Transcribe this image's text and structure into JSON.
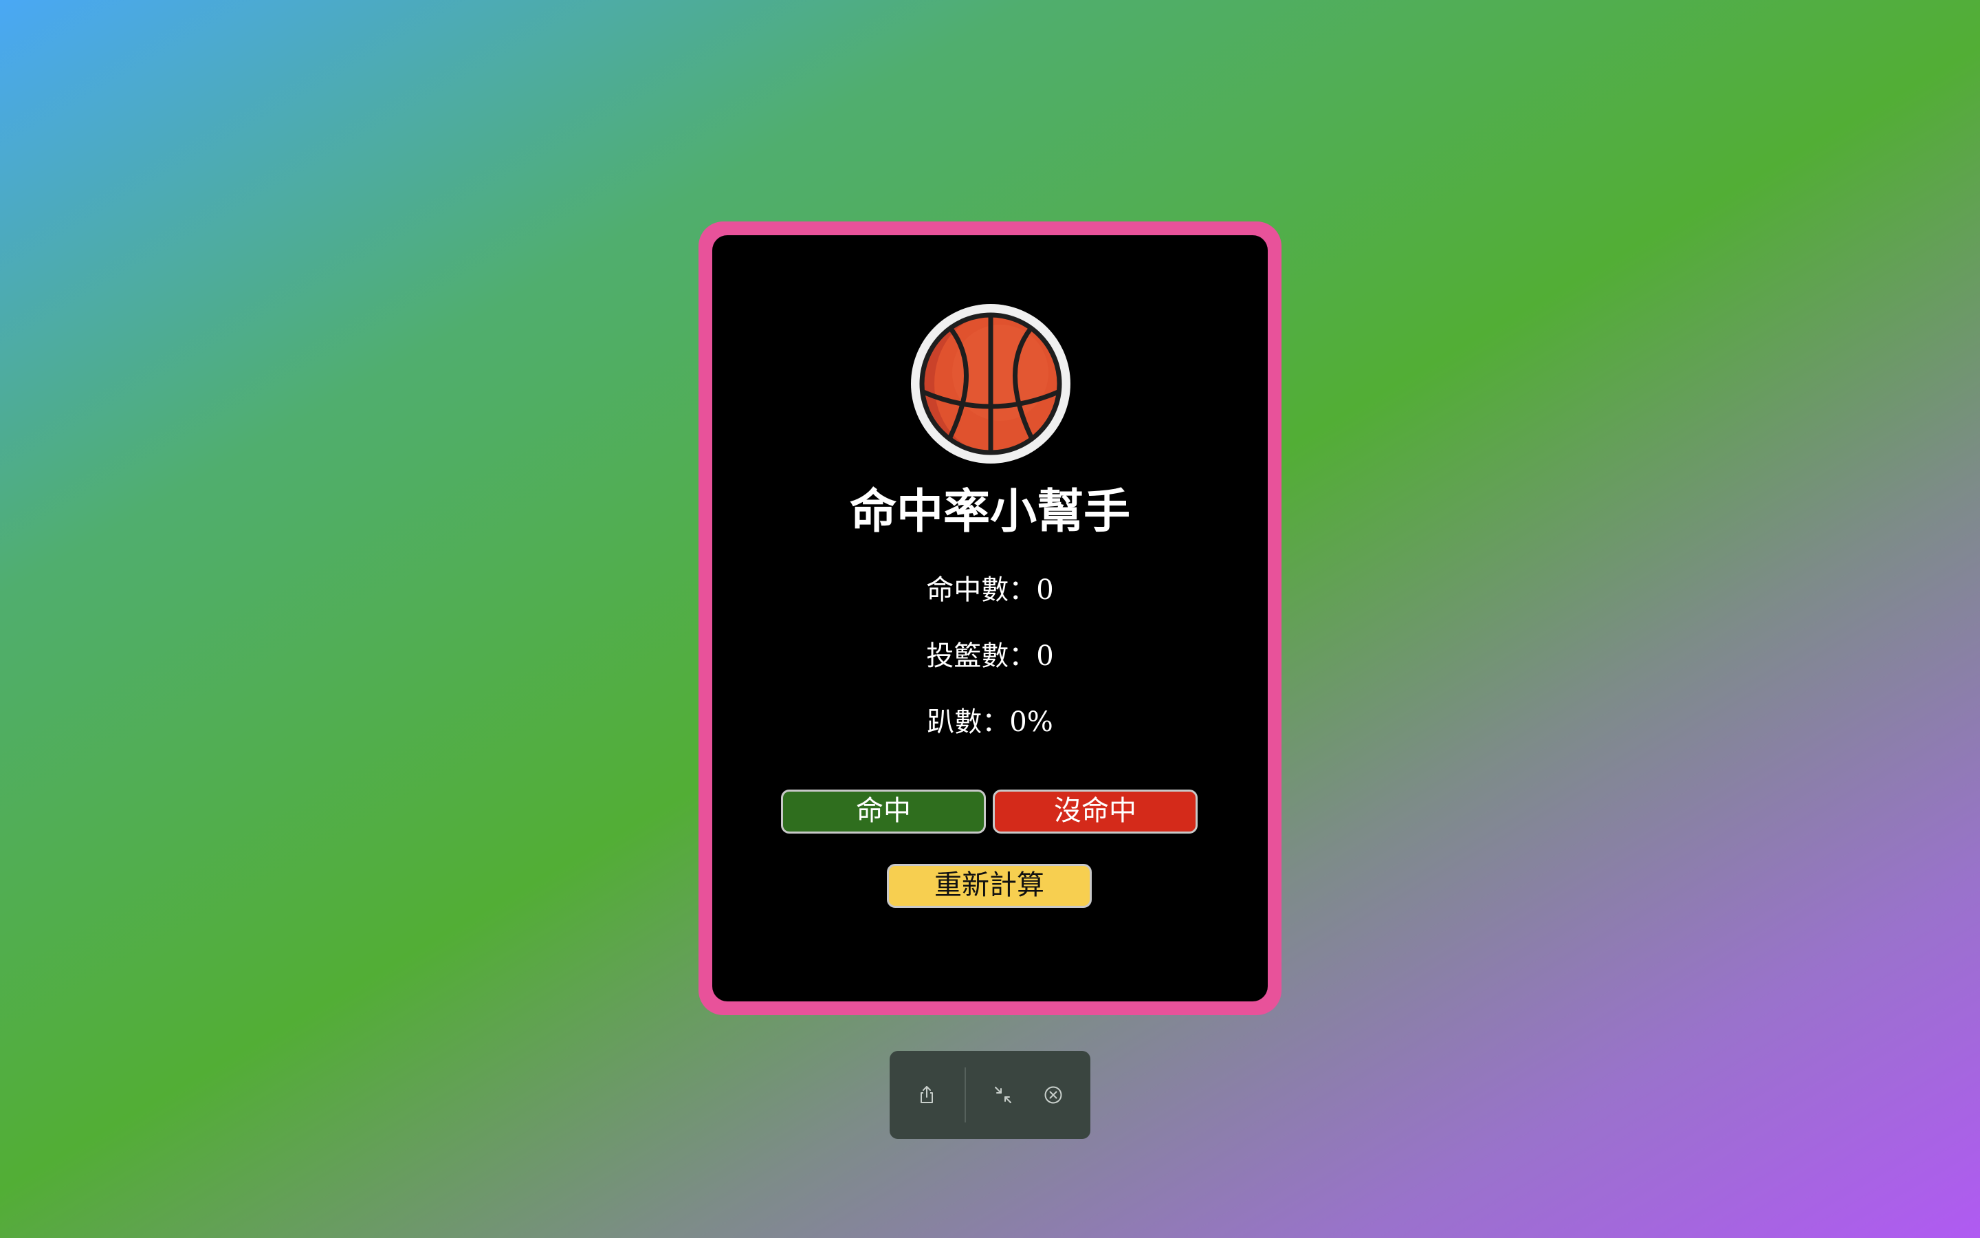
{
  "app": {
    "title": "命中率小幫手",
    "accent_color": "#e8529a",
    "logo_icon": "basketball-icon"
  },
  "stats": {
    "made_label": "命中數：0",
    "attempts_label": "投籃數：0",
    "percentage_label": "趴數：0%"
  },
  "buttons": {
    "hit_label": "命中",
    "miss_label": "沒命中",
    "reset_label": "重新計算",
    "hit_color": "#2f6e1e",
    "miss_color": "#d42a1a",
    "reset_color": "#f7cf50"
  },
  "toolbar": {
    "share_icon": "share-icon",
    "shrink_icon": "shrink-icon",
    "close_icon": "close-circle-icon"
  }
}
